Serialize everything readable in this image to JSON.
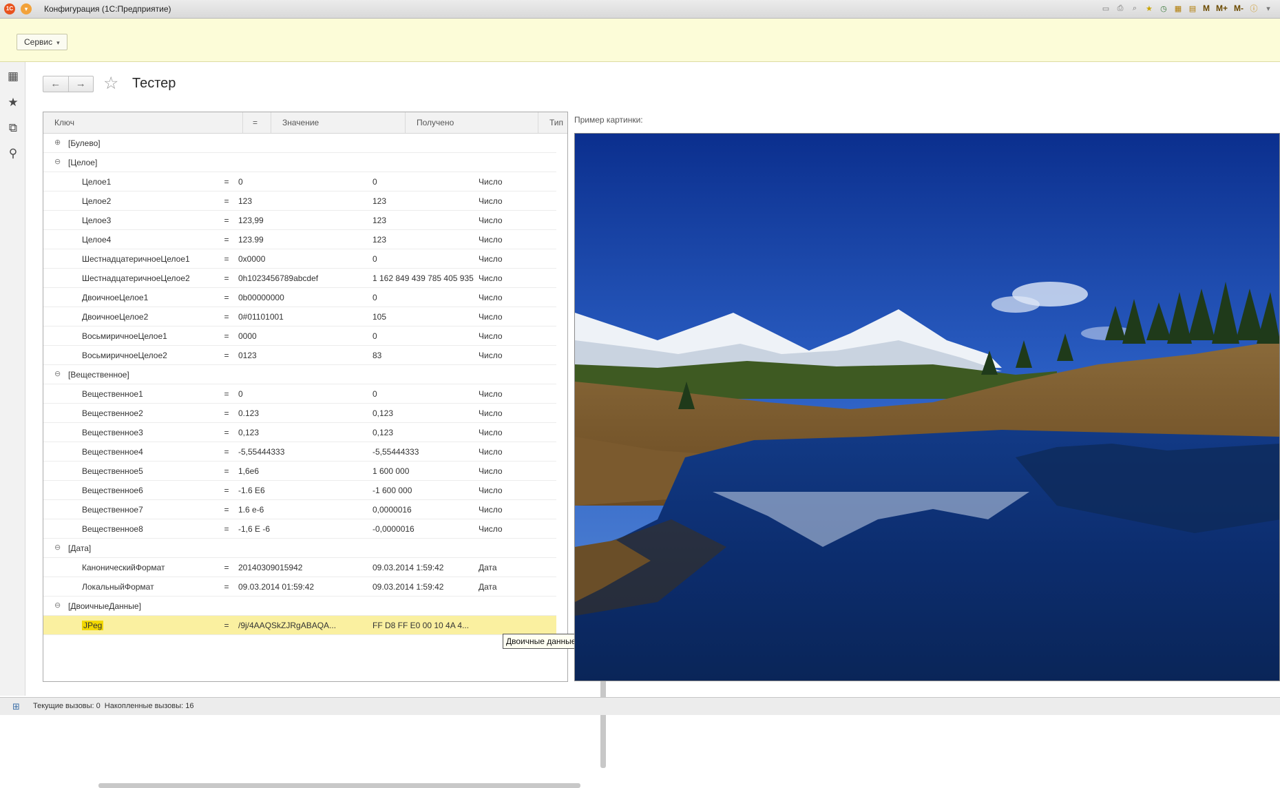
{
  "window": {
    "title": "Конфигурация (1С:Предприятие)",
    "logo_text": "1С"
  },
  "toolbar_icons": [
    "save-icon",
    "print-icon",
    "preview-icon",
    "favorites-add-icon",
    "history-icon",
    "calendar-icon",
    "calculator-icon",
    "M",
    "M+",
    "M-",
    "info-icon"
  ],
  "toolbar_m_labels": {
    "m": "M",
    "m_plus": "M+",
    "m_minus": "M-"
  },
  "service": {
    "label": "Сервис",
    "caret": "▾"
  },
  "header": {
    "title": "Тестер",
    "back": "←",
    "forward": "→",
    "star": "☆"
  },
  "grid": {
    "columns": {
      "key": "Ключ",
      "eq": "=",
      "value": "Значение",
      "received": "Получено",
      "type": "Тип"
    },
    "rows": [
      {
        "kind": "group",
        "toggle": "⊕",
        "label": "[Булево]"
      },
      {
        "kind": "group",
        "toggle": "⊖",
        "label": "[Целое]"
      },
      {
        "kind": "item",
        "key": "Целое1",
        "eq": "=",
        "value": "0",
        "received": "0",
        "type": "Число"
      },
      {
        "kind": "item",
        "key": "Целое2",
        "eq": "=",
        "value": "123",
        "received": "123",
        "type": "Число"
      },
      {
        "kind": "item",
        "key": "Целое3",
        "eq": "=",
        "value": "123,99",
        "received": "123",
        "type": "Число"
      },
      {
        "kind": "item",
        "key": "Целое4",
        "eq": "=",
        "value": "123.99",
        "received": "123",
        "type": "Число"
      },
      {
        "kind": "item",
        "key": "ШестнадцатеричноеЦелое1",
        "eq": "=",
        "value": "0x0000",
        "received": "0",
        "type": "Число"
      },
      {
        "kind": "item",
        "key": "ШестнадцатеричноеЦелое2",
        "eq": "=",
        "value": "0h1023456789abcdef",
        "received": "1 162 849 439 785 405 935",
        "type": "Число"
      },
      {
        "kind": "item",
        "key": "ДвоичноеЦелое1",
        "eq": "=",
        "value": "0b00000000",
        "received": "0",
        "type": "Число"
      },
      {
        "kind": "item",
        "key": "ДвоичноеЦелое2",
        "eq": "=",
        "value": "0#01101001",
        "received": "105",
        "type": "Число"
      },
      {
        "kind": "item",
        "key": "ВосьмиричноеЦелое1",
        "eq": "=",
        "value": "0000",
        "received": "0",
        "type": "Число"
      },
      {
        "kind": "item",
        "key": "ВосьмиричноеЦелое2",
        "eq": "=",
        "value": "0123",
        "received": "83",
        "type": "Число"
      },
      {
        "kind": "group",
        "toggle": "⊖",
        "label": "[Вещественное]"
      },
      {
        "kind": "item",
        "key": "Вещественное1",
        "eq": "=",
        "value": "0",
        "received": "0",
        "type": "Число"
      },
      {
        "kind": "item",
        "key": "Вещественное2",
        "eq": "=",
        "value": "0.123",
        "received": "0,123",
        "type": "Число"
      },
      {
        "kind": "item",
        "key": "Вещественное3",
        "eq": "=",
        "value": "0,123",
        "received": "0,123",
        "type": "Число"
      },
      {
        "kind": "item",
        "key": "Вещественное4",
        "eq": "=",
        "value": "-5,55444333",
        "received": "-5,55444333",
        "type": "Число"
      },
      {
        "kind": "item",
        "key": "Вещественное5",
        "eq": "=",
        "value": "1,6e6",
        "received": "1 600 000",
        "type": "Число"
      },
      {
        "kind": "item",
        "key": "Вещественное6",
        "eq": "=",
        "value": "-1.6 E6",
        "received": "-1 600 000",
        "type": "Число"
      },
      {
        "kind": "item",
        "key": "Вещественное7",
        "eq": "=",
        "value": "1.6 e-6",
        "received": "0,0000016",
        "type": "Число"
      },
      {
        "kind": "item",
        "key": "Вещественное8",
        "eq": "=",
        "value": "-1,6 E -6",
        "received": "-0,0000016",
        "type": "Число"
      },
      {
        "kind": "group",
        "toggle": "⊖",
        "label": "[Дата]"
      },
      {
        "kind": "item",
        "key": "КаноническийФормат",
        "eq": "=",
        "value": "20140309015942",
        "received": "09.03.2014 1:59:42",
        "type": "Дата"
      },
      {
        "kind": "item",
        "key": "ЛокальныйФормат",
        "eq": "=",
        "value": "09.03.2014 01:59:42",
        "received": "09.03.2014 1:59:42",
        "type": "Дата"
      },
      {
        "kind": "group",
        "toggle": "⊖",
        "label": "[ДвоичныеДанные]"
      },
      {
        "kind": "item",
        "selected": true,
        "key": "JPeg",
        "eq": "=",
        "value": "/9j/4AAQSkZJRgABAQA...",
        "received": "FF D8 FF E0 00 10 4A 4...",
        "type": ""
      }
    ],
    "tooltip": "Двоичные данные"
  },
  "picture": {
    "label": "Пример картинки:"
  },
  "status": {
    "current_calls": "Текущие вызовы: 0",
    "accumulated_calls": "Накопленные вызовы: 16"
  },
  "colors": {
    "service_panel_bg": "#fcfcd8",
    "selected_row_bg": "#faf0a0",
    "key_highlight": "#f2d800",
    "logo": "#e8531f"
  }
}
